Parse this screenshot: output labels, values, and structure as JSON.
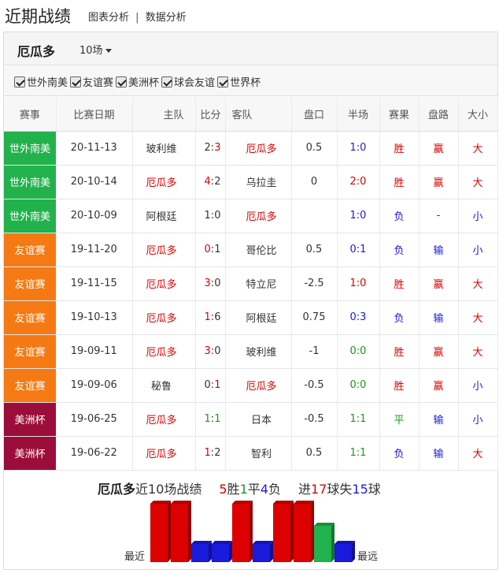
{
  "page": {
    "title": "近期战绩"
  },
  "nav": {
    "chart_link": "图表分析",
    "separator": "|",
    "data_link": "数据分析"
  },
  "panel": {
    "team_name": "厄瓜多",
    "count_label": "10场"
  },
  "filters": [
    {
      "label": "世外南美",
      "checked": true
    },
    {
      "label": "友谊赛",
      "checked": true
    },
    {
      "label": "美洲杯",
      "checked": true
    },
    {
      "label": "球会友谊",
      "checked": true
    },
    {
      "label": "世界杯",
      "checked": true
    }
  ],
  "columns": [
    "赛事",
    "比赛日期",
    "主队",
    "比分",
    "客队",
    "盘口",
    "半场",
    "赛果",
    "盘路",
    "大小"
  ],
  "colors": {
    "sa_qualifier": "#22b24c",
    "friendly": "#f57a13",
    "copa": "#9b0d3b",
    "win": "#dd0000",
    "draw": "#1a9a1a",
    "loss": "#1a1adc"
  },
  "matches": [
    {
      "league": "世外南美",
      "league_color": "#22b24c",
      "date": "20-11-13",
      "home": "玻利维",
      "home_class": "dark",
      "score_h": "2",
      "score_a": "3",
      "score_h_class": "dark",
      "score_a_class": "red",
      "away": "厄瓜多",
      "away_class": "red",
      "handicap": "0.5",
      "half": "1:0",
      "half_class": "blue",
      "result": "胜",
      "result_class": "red",
      "pan": "赢",
      "pan_class": "red",
      "ou": "大",
      "ou_class": "red"
    },
    {
      "league": "世外南美",
      "league_color": "#22b24c",
      "date": "20-10-14",
      "home": "厄瓜多",
      "home_class": "red",
      "score_h": "4",
      "score_a": "2",
      "score_h_class": "red",
      "score_a_class": "dark",
      "away": "乌拉圭",
      "away_class": "dark",
      "handicap": "0",
      "half": "2:0",
      "half_class": "red",
      "result": "胜",
      "result_class": "red",
      "pan": "赢",
      "pan_class": "red",
      "ou": "大",
      "ou_class": "red"
    },
    {
      "league": "世外南美",
      "league_color": "#22b24c",
      "date": "20-10-09",
      "home": "阿根廷",
      "home_class": "dark",
      "score_h": "1",
      "score_a": "0",
      "score_h_class": "dark",
      "score_a_class": "dark",
      "away": "厄瓜多",
      "away_class": "red",
      "handicap": "",
      "half": "1:0",
      "half_class": "blue",
      "result": "负",
      "result_class": "blue",
      "pan": "-",
      "pan_class": "dark",
      "ou": "小",
      "ou_class": "blue"
    },
    {
      "league": "友谊赛",
      "league_color": "#f57a13",
      "date": "19-11-20",
      "home": "厄瓜多",
      "home_class": "red",
      "score_h": "0",
      "score_a": "1",
      "score_h_class": "red",
      "score_a_class": "dark",
      "away": "哥伦比",
      "away_class": "dark",
      "handicap": "0.5",
      "half": "0:1",
      "half_class": "blue",
      "result": "负",
      "result_class": "blue",
      "pan": "输",
      "pan_class": "blue",
      "ou": "小",
      "ou_class": "blue"
    },
    {
      "league": "友谊赛",
      "league_color": "#f57a13",
      "date": "19-11-15",
      "home": "厄瓜多",
      "home_class": "red",
      "score_h": "3",
      "score_a": "0",
      "score_h_class": "red",
      "score_a_class": "dark",
      "away": "特立尼",
      "away_class": "dark",
      "handicap": "-2.5",
      "half": "1:0",
      "half_class": "red",
      "result": "胜",
      "result_class": "red",
      "pan": "赢",
      "pan_class": "red",
      "ou": "大",
      "ou_class": "red"
    },
    {
      "league": "友谊赛",
      "league_color": "#f57a13",
      "date": "19-10-13",
      "home": "厄瓜多",
      "home_class": "red",
      "score_h": "1",
      "score_a": "6",
      "score_h_class": "red",
      "score_a_class": "dark",
      "away": "阿根廷",
      "away_class": "dark",
      "handicap": "0.75",
      "half": "0:3",
      "half_class": "blue",
      "result": "负",
      "result_class": "blue",
      "pan": "输",
      "pan_class": "blue",
      "ou": "大",
      "ou_class": "red"
    },
    {
      "league": "友谊赛",
      "league_color": "#f57a13",
      "date": "19-09-11",
      "home": "厄瓜多",
      "home_class": "red",
      "score_h": "3",
      "score_a": "0",
      "score_h_class": "red",
      "score_a_class": "dark",
      "away": "玻利维",
      "away_class": "dark",
      "handicap": "-1",
      "half": "0:0",
      "half_class": "green",
      "result": "胜",
      "result_class": "red",
      "pan": "赢",
      "pan_class": "red",
      "ou": "大",
      "ou_class": "red"
    },
    {
      "league": "友谊赛",
      "league_color": "#f57a13",
      "date": "19-09-06",
      "home": "秘鲁",
      "home_class": "dark",
      "score_h": "0",
      "score_a": "1",
      "score_h_class": "dark",
      "score_a_class": "red",
      "away": "厄瓜多",
      "away_class": "red",
      "handicap": "-0.5",
      "half": "0:0",
      "half_class": "green",
      "result": "胜",
      "result_class": "red",
      "pan": "赢",
      "pan_class": "red",
      "ou": "小",
      "ou_class": "blue"
    },
    {
      "league": "美洲杯",
      "league_color": "#9b0d3b",
      "date": "19-06-25",
      "home": "厄瓜多",
      "home_class": "red",
      "score_h": "1",
      "score_a": "1",
      "score_h_class": "green",
      "score_a_class": "green",
      "away": "日本",
      "away_class": "dark",
      "handicap": "-0.5",
      "half": "1:1",
      "half_class": "green",
      "result": "平",
      "result_class": "green",
      "pan": "输",
      "pan_class": "blue",
      "ou": "小",
      "ou_class": "blue"
    },
    {
      "league": "美洲杯",
      "league_color": "#9b0d3b",
      "date": "19-06-22",
      "home": "厄瓜多",
      "home_class": "red",
      "score_h": "1",
      "score_a": "2",
      "score_h_class": "red",
      "score_a_class": "dark",
      "away": "智利",
      "away_class": "dark",
      "handicap": "0.5",
      "half": "1:1",
      "half_class": "green",
      "result": "负",
      "result_class": "blue",
      "pan": "输",
      "pan_class": "blue",
      "ou": "大",
      "ou_class": "red"
    }
  ],
  "summary": {
    "team": "厄瓜多",
    "text_recent": "近10场战绩",
    "wins": "5",
    "win_label": "胜",
    "draws": "1",
    "draw_label": "平",
    "losses": "4",
    "loss_label": "负",
    "goals_for_label": "进",
    "goals_for": "17",
    "goals_for_unit": "球",
    "goals_against_label": "失",
    "goals_against": "15",
    "goals_against_unit": "球",
    "left_label": "最近",
    "right_label": "最远"
  },
  "chart_data": {
    "type": "bar",
    "categories": [
      "20-11-13",
      "20-10-14",
      "20-10-09",
      "19-11-20",
      "19-11-15",
      "19-10-13",
      "19-09-11",
      "19-09-06",
      "19-06-25",
      "19-06-22"
    ],
    "values": [
      "胜",
      "胜",
      "负",
      "负",
      "胜",
      "负",
      "胜",
      "胜",
      "平",
      "负"
    ],
    "legend": {
      "胜": "#dd0000",
      "平": "#22b24c",
      "负": "#1a1adc"
    },
    "xlabel": "",
    "ylabel": ""
  }
}
